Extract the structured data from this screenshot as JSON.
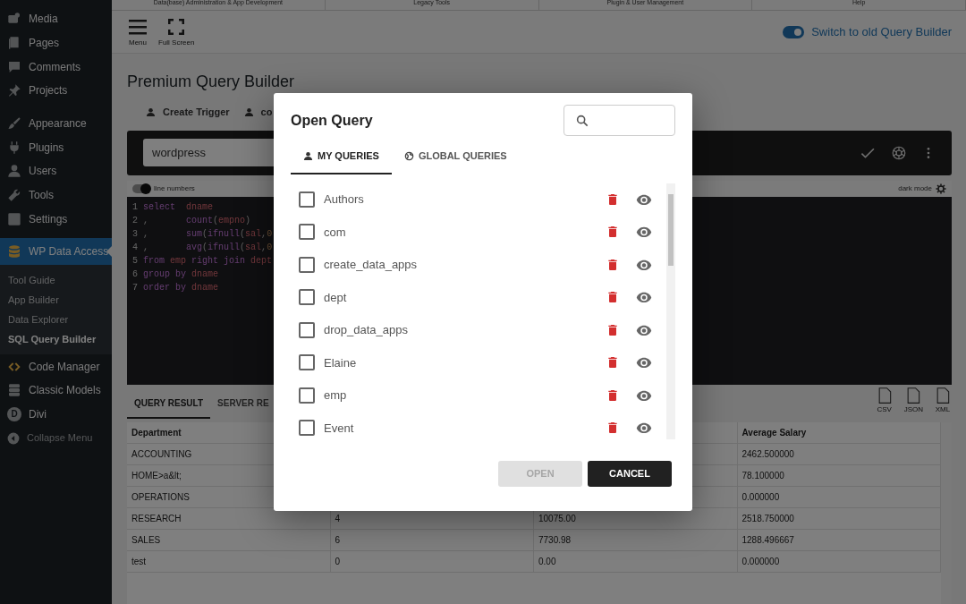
{
  "top_tabs": [
    "Data(base) Administration & App Development",
    "Legacy Tools",
    "Plugin & User Management",
    "Help"
  ],
  "sidebar": {
    "items": [
      {
        "label": "Media",
        "selected": false
      },
      {
        "label": "Pages",
        "selected": false
      },
      {
        "label": "Comments",
        "selected": false
      },
      {
        "label": "Projects",
        "selected": false
      },
      {
        "label": "Appearance",
        "selected": false
      },
      {
        "label": "Plugins",
        "selected": false
      },
      {
        "label": "Users",
        "selected": false
      },
      {
        "label": "Tools",
        "selected": false
      },
      {
        "label": "Settings",
        "selected": false
      },
      {
        "label": "WP Data Access",
        "selected": true,
        "children": [
          {
            "label": "Tool Guide",
            "selected": false
          },
          {
            "label": "App Builder",
            "selected": false
          },
          {
            "label": "Data Explorer",
            "selected": false
          },
          {
            "label": "SQL Query Builder",
            "selected": true
          }
        ]
      },
      {
        "label": "Code Manager",
        "selected": false
      },
      {
        "label": "Classic Models",
        "selected": false
      },
      {
        "label": "Divi",
        "letter": "D",
        "selected": false
      },
      {
        "label": "Collapse Menu",
        "selected": false
      }
    ]
  },
  "toolbar": {
    "buttons": [
      {
        "label": "Menu"
      },
      {
        "label": "Full Screen"
      }
    ],
    "switch": {
      "label": "Switch to old Query Builder",
      "on": true
    }
  },
  "page_title": "Premium Query Builder",
  "action_tabs": [
    "Create Trigger",
    "co"
  ],
  "database_field": {
    "value": "wordpress"
  },
  "editor": {
    "line_numbers": {
      "label": "line numbers",
      "on": true
    },
    "dark_mode_label": "dark mode",
    "lines": [
      {
        "number": "1",
        "tokens": [
          {
            "text": "select  ",
            "kind": "keyword"
          },
          {
            "text": "dname",
            "kind": "name"
          }
        ]
      },
      {
        "number": "2",
        "tokens": [
          {
            "text": ",       ",
            "kind": "punct"
          },
          {
            "text": "count",
            "kind": "keyword"
          },
          {
            "text": "(",
            "kind": "punct"
          },
          {
            "text": "empno",
            "kind": "name"
          },
          {
            "text": ")",
            "kind": "punct"
          }
        ]
      },
      {
        "number": "3",
        "tokens": [
          {
            "text": ",       ",
            "kind": "punct"
          },
          {
            "text": "sum",
            "kind": "keyword"
          },
          {
            "text": "(",
            "kind": "punct"
          },
          {
            "text": "ifnull",
            "kind": "keyword"
          },
          {
            "text": "(",
            "kind": "punct"
          },
          {
            "text": "sal",
            "kind": "name"
          },
          {
            "text": ",",
            "kind": "punct"
          },
          {
            "text": "0",
            "kind": "number"
          }
        ]
      },
      {
        "number": "4",
        "tokens": [
          {
            "text": ",       ",
            "kind": "punct"
          },
          {
            "text": "avg",
            "kind": "keyword"
          },
          {
            "text": "(",
            "kind": "punct"
          },
          {
            "text": "ifnull",
            "kind": "keyword"
          },
          {
            "text": "(",
            "kind": "punct"
          },
          {
            "text": "sal",
            "kind": "name"
          },
          {
            "text": ",",
            "kind": "punct"
          },
          {
            "text": "0",
            "kind": "number"
          }
        ]
      },
      {
        "number": "5",
        "tokens": [
          {
            "text": "from ",
            "kind": "keyword"
          },
          {
            "text": "emp ",
            "kind": "name"
          },
          {
            "text": "right join ",
            "kind": "keyword"
          },
          {
            "text": "dept",
            "kind": "name"
          }
        ]
      },
      {
        "number": "6",
        "tokens": [
          {
            "text": "group by ",
            "kind": "keyword"
          },
          {
            "text": "dname",
            "kind": "name"
          }
        ]
      },
      {
        "number": "7",
        "tokens": [
          {
            "text": "order by ",
            "kind": "keyword"
          },
          {
            "text": "dname",
            "kind": "name"
          }
        ]
      }
    ]
  },
  "result_tabs": [
    {
      "label": "QUERY RESULT",
      "selected": true
    },
    {
      "label": "SERVER RE",
      "selected": false
    }
  ],
  "export_buttons": [
    "CSV",
    "JSON",
    "XML"
  ],
  "table": {
    "columns": [
      "Department",
      null,
      null,
      "Average Salary"
    ],
    "rows": [
      [
        "ACCOUNTING",
        null,
        null,
        "2462.500000"
      ],
      [
        "HOME>a&lt;",
        null,
        null,
        "78.100000"
      ],
      [
        "OPERATIONS",
        null,
        null,
        "0.000000"
      ],
      [
        "RESEARCH",
        "4",
        "10075.00",
        "2518.750000"
      ],
      [
        "SALES",
        "6",
        "7730.98",
        "1288.496667"
      ],
      [
        "test",
        "0",
        "0.00",
        "0.000000"
      ]
    ]
  },
  "dialog": {
    "title": "Open Query",
    "tabs": [
      {
        "label": "MY QUERIES",
        "selected": true
      },
      {
        "label": "GLOBAL QUERIES",
        "selected": false
      }
    ],
    "queries": [
      {
        "name": "Authors",
        "checked": false
      },
      {
        "name": "com",
        "checked": false
      },
      {
        "name": "create_data_apps",
        "checked": false
      },
      {
        "name": "dept",
        "checked": false
      },
      {
        "name": "drop_data_apps",
        "checked": false
      },
      {
        "name": "Elaine",
        "checked": false
      },
      {
        "name": "emp",
        "checked": false
      },
      {
        "name": "Event",
        "checked": false
      }
    ],
    "buttons": [
      {
        "label": "OPEN",
        "kind": "secondary",
        "disabled": true
      },
      {
        "label": "CANCEL",
        "kind": "primary",
        "disabled": false
      }
    ]
  }
}
